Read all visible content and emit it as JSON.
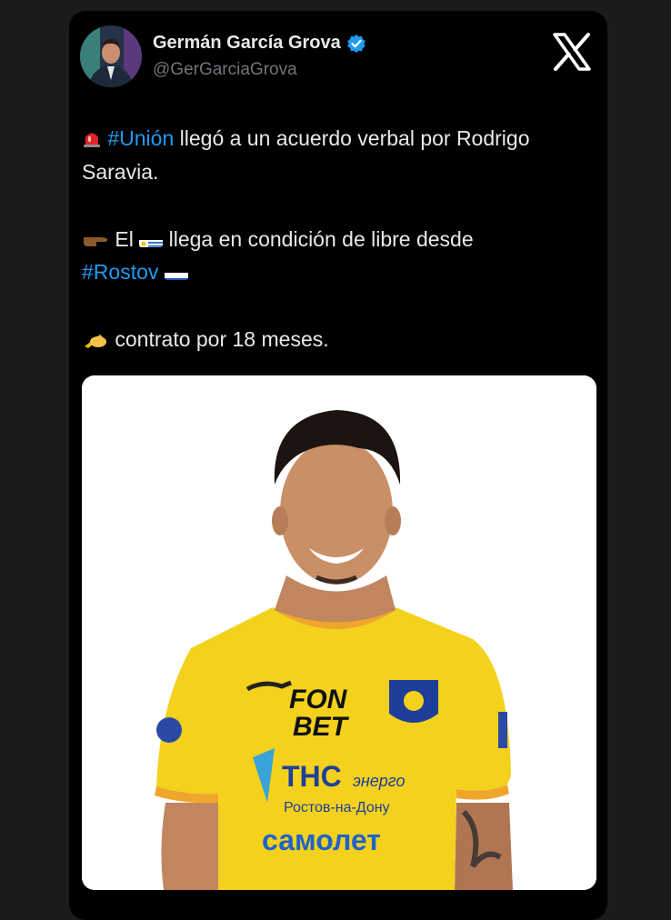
{
  "author": {
    "name": "Germán García Grova",
    "handle": "@GerGarciaGrova"
  },
  "icons": {
    "verified": "verified-badge-icon",
    "platform": "x-logo-icon",
    "siren": "police-light-icon",
    "pointing": "pointing-right-icon",
    "writing": "writing-hand-icon"
  },
  "tweet": {
    "line1_tag": "#Unión",
    "line1_text": " llegó a un acuerdo verbal por Rodrigo Saravia.",
    "line2_pre": "El ",
    "line2_post": "llega en condición de libre desde",
    "line3_tag": "#Rostov",
    "line4_text": "contrato por 18 meses."
  },
  "media": {
    "shirt_sponsor1_l1": "FON",
    "shirt_sponsor1_l2": "BET",
    "shirt_sponsor2_main": "ТНС",
    "shirt_sponsor2_sub": "энерго",
    "shirt_sponsor2_city": "Ростов-на-Дону",
    "shirt_sponsor3": "самолет"
  },
  "colors": {
    "background": "#000000",
    "link": "#1d9bf0",
    "text": "#e7e9ea",
    "secondary": "#71767b",
    "jersey": "#f3d11d"
  }
}
